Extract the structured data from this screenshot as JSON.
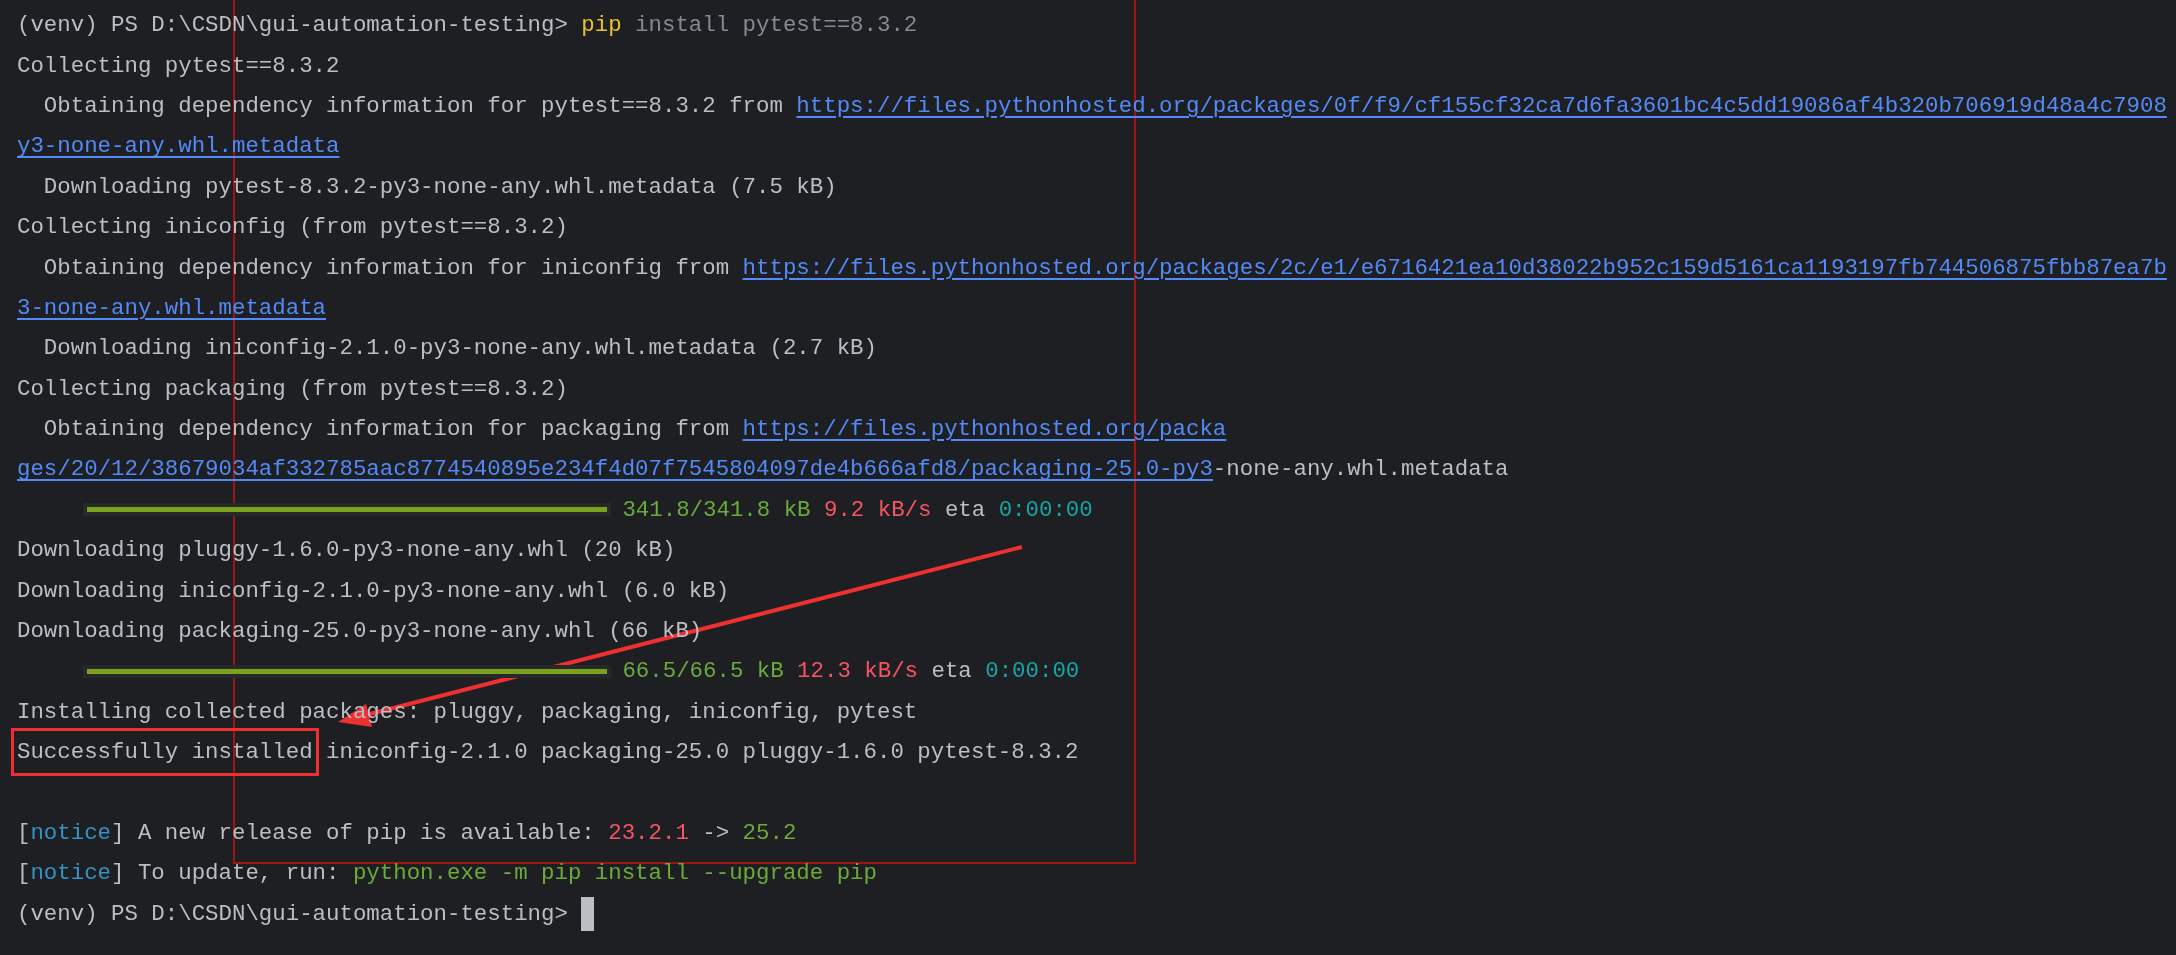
{
  "terminal": {
    "lines": [
      {
        "segments": [
          {
            "kind": "prompt",
            "text": "(venv) PS D:\\CSDN\\gui-automation-testing> "
          },
          {
            "kind": "command",
            "text": "pip"
          },
          {
            "kind": "argument",
            "text": " install pytest==8.3.2"
          }
        ]
      },
      {
        "segments": [
          {
            "kind": "plain",
            "text": "Collecting pytest==8.3.2"
          }
        ]
      },
      {
        "segments": [
          {
            "kind": "plain",
            "text": "  Obtaining dependency information for pytest==8.3.2 from "
          },
          {
            "kind": "link",
            "text": "https://files.pythonhosted.org/packages/0f/f9/cf155cf32ca7d6fa3601bc4c5dd19086af4b320b706919d48a4c7908"
          }
        ]
      },
      {
        "segments": [
          {
            "kind": "link",
            "text": "y3-none-any.whl.metadata"
          }
        ]
      },
      {
        "segments": [
          {
            "kind": "plain",
            "text": "  Downloading pytest-8.3.2-py3-none-any.whl.metadata (7.5 kB)"
          }
        ]
      },
      {
        "segments": [
          {
            "kind": "plain",
            "text": "Collecting iniconfig (from pytest==8.3.2)"
          }
        ]
      },
      {
        "segments": [
          {
            "kind": "plain",
            "text": "  Obtaining dependency information for iniconfig from "
          },
          {
            "kind": "link",
            "text": "https://files.pythonhosted.org/packages/2c/e1/e6716421ea10d38022b952c159d5161ca1193197fb744506875fbb87ea7b"
          }
        ]
      },
      {
        "segments": [
          {
            "kind": "link",
            "text": "3-none-any.whl.metadata"
          }
        ]
      },
      {
        "segments": [
          {
            "kind": "plain",
            "text": "  Downloading iniconfig-2.1.0-py3-none-any.whl.metadata (2.7 kB)"
          }
        ]
      },
      {
        "segments": [
          {
            "kind": "plain",
            "text": "Collecting packaging (from pytest==8.3.2)"
          }
        ]
      },
      {
        "segments": [
          {
            "kind": "plain",
            "text": "  Obtaining dependency information for packaging from "
          },
          {
            "kind": "link",
            "text": "https://files.pythonhosted.org/packa"
          }
        ]
      },
      {
        "segments": [
          {
            "kind": "link",
            "text": "ges/20/12/38679034af332785aac8774540895e234f4d07f7545804097de4b666afd8/packaging-25.0-py3"
          },
          {
            "kind": "plain",
            "text": "-none-any.whl.metadata"
          }
        ]
      },
      {
        "segments": [
          {
            "kind": "progress",
            "level": 1
          },
          {
            "kind": "size",
            "text": " 341.8/341.8 kB"
          },
          {
            "kind": "rate",
            "text": " 9.2 kB/s"
          },
          {
            "kind": "plain",
            "text": " eta"
          },
          {
            "kind": "eta",
            "text": " 0:00:00"
          }
        ]
      },
      {
        "segments": [
          {
            "kind": "plain",
            "text": "Downloading pluggy-1.6.0-py3-none-any.whl (20 kB)"
          }
        ]
      },
      {
        "segments": [
          {
            "kind": "plain",
            "text": "Downloading iniconfig-2.1.0-py3-none-any.whl (6.0 kB)"
          }
        ]
      },
      {
        "segments": [
          {
            "kind": "plain",
            "text": "Downloading packaging-25.0-py3-none-any.whl (66 kB)"
          }
        ]
      },
      {
        "segments": [
          {
            "kind": "progress",
            "level": 1
          },
          {
            "kind": "size",
            "text": " 66.5/66.5 kB"
          },
          {
            "kind": "rate",
            "text": " 12.3 kB/s"
          },
          {
            "kind": "plain",
            "text": " eta"
          },
          {
            "kind": "eta",
            "text": " 0:00:00"
          }
        ]
      },
      {
        "segments": [
          {
            "kind": "plain",
            "text": "Installing collected packages: pluggy, packaging, iniconfig, pytest"
          }
        ]
      },
      {
        "segments": [
          {
            "kind": "plain",
            "text": "Successfully installed",
            "highlighted": true
          },
          {
            "kind": "plain",
            "text": " iniconfig-2.1.0 packaging-25.0 pluggy-1.6.0 pytest-8.3.2"
          }
        ]
      },
      {
        "kind": "blank"
      },
      {
        "segments": [
          {
            "kind": "plain",
            "text": "["
          },
          {
            "kind": "notice",
            "text": "notice"
          },
          {
            "kind": "plain",
            "text": "] A new release of pip is available: "
          },
          {
            "kind": "old-version",
            "text": "23.2.1"
          },
          {
            "kind": "plain",
            "text": " -> "
          },
          {
            "kind": "new-version",
            "text": "25.2"
          }
        ]
      },
      {
        "segments": [
          {
            "kind": "plain",
            "text": "["
          },
          {
            "kind": "notice",
            "text": "notice"
          },
          {
            "kind": "plain",
            "text": "] To update, run: "
          },
          {
            "kind": "suggestion",
            "text": "python.exe -m pip install --upgrade pip"
          }
        ]
      },
      {
        "segments": [
          {
            "kind": "prompt",
            "text": "(venv) PS D:\\CSDN\\gui-automation-testing> "
          },
          {
            "kind": "cursor"
          }
        ]
      }
    ]
  }
}
